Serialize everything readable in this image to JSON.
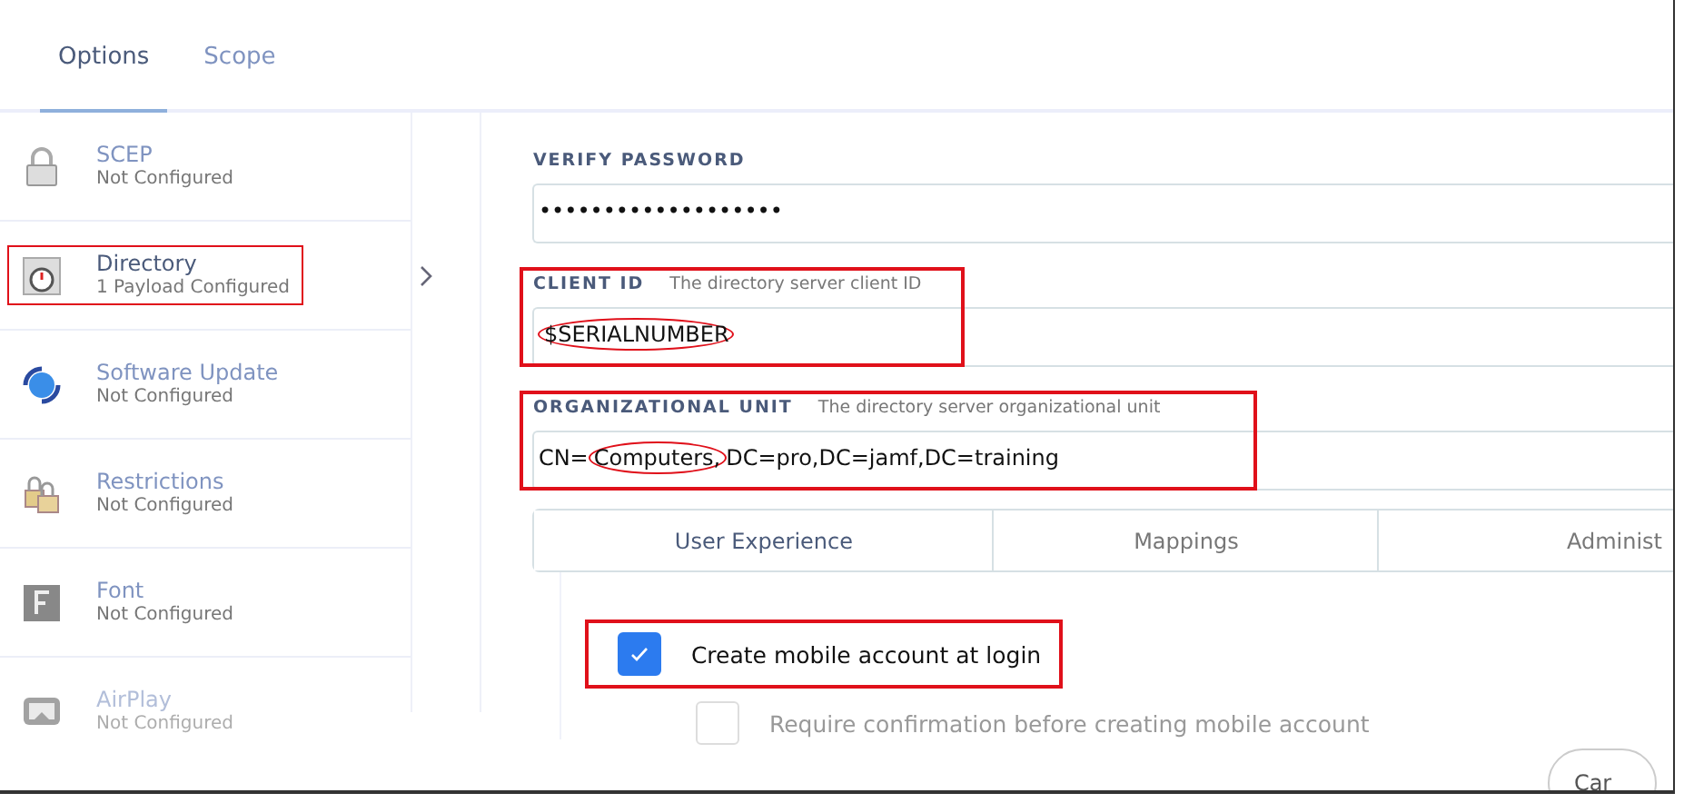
{
  "tabs": [
    {
      "label": "Options",
      "selected": true
    },
    {
      "label": "Scope",
      "selected": false
    }
  ],
  "sidebar": {
    "items": [
      {
        "title": "SCEP",
        "status": "Not Configured",
        "selected": false,
        "highlighted": false
      },
      {
        "title": "Directory",
        "status": "1 Payload Configured",
        "selected": true,
        "highlighted": true
      },
      {
        "title": "Software Update",
        "status": "Not Configured",
        "selected": false,
        "highlighted": false
      },
      {
        "title": "Restrictions",
        "status": "Not Configured",
        "selected": false,
        "highlighted": false
      },
      {
        "title": "Font",
        "status": "Not Configured",
        "selected": false,
        "highlighted": false
      },
      {
        "title": "AirPlay",
        "status": "Not Configured",
        "selected": false,
        "highlighted": false
      }
    ]
  },
  "fields": [
    {
      "label": "VERIFY PASSWORD",
      "parts": [
        {
          "text": "•••••••••••••••••••",
          "circled": false
        }
      ],
      "highlighted": false
    },
    {
      "label": "CLIENT ID",
      "hint": "The directory server client ID",
      "parts": [
        {
          "text": "$SERIALNUMBER",
          "circled": true
        }
      ],
      "highlighted": true
    },
    {
      "label": "ORGANIZATIONAL UNIT",
      "hint": "The directory server organizational unit",
      "parts": [
        {
          "text": "CN=",
          "circled": false
        },
        {
          "text": "Computers,",
          "circled": true
        },
        {
          "text": "DC=pro,DC=jamf,DC=training",
          "circled": false
        }
      ],
      "highlighted": true
    }
  ],
  "section_tabs": [
    {
      "label": "User Experience",
      "selected": true
    },
    {
      "label": "Mappings",
      "selected": false
    },
    {
      "label": "Administ",
      "selected": false
    }
  ],
  "options": [
    {
      "label": "Create mobile account at login",
      "checked": true,
      "disabled": false,
      "highlighted": true
    },
    {
      "label": "Require confirmation before creating mobile account",
      "checked": false,
      "disabled": true,
      "highlighted": false
    }
  ],
  "footer_button": "Car"
}
